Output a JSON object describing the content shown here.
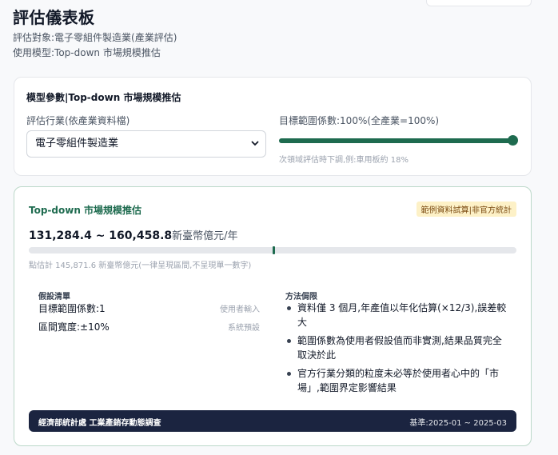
{
  "header": {
    "title": "評估儀表板",
    "target_line": "評估對象:電子零組件製造業(產業評估)",
    "model_line": "使用模型:Top-down 市場規模推估"
  },
  "params_card": {
    "title": "模型參數|Top-down 市場規模推估",
    "industry_label": "評估行業(依產業資料檔)",
    "industry_value": "電子零組件製造業",
    "range_label": "目標範圍係數:100%(全產業=100%)",
    "range_value_percent": 100,
    "range_hint": "次領域評估時下調,例:車用板約 18%"
  },
  "result_card": {
    "title": "Top-down 市場規模推估",
    "badge": "範例資料試算|非官方統計",
    "range_numbers": "131,284.4 ~ 160,458.8",
    "range_unit": "新臺幣億元/年",
    "point_fraction": 0.5,
    "point_note": "點估計 145,871.6 新臺幣億元(一律呈現區間,不呈現單一數字)",
    "assumptions_title": "假設清單",
    "assumptions": [
      {
        "label": "目標範圍係數:1",
        "source": "使用者輸入"
      },
      {
        "label": "區間寬度:±10%",
        "source": "系統預設"
      }
    ],
    "limits_title": "方法侷限",
    "limits": [
      "資料僅 3 個月,年產值以年化估算(×12/3),誤差較大",
      "範圍係數為使用者假設值而非實測,結果品質完全取決於此",
      "官方行業分類的粒度未必等於使用者心中的「市場」,範圍界定影響結果"
    ],
    "footer_source": "經濟部統計處 工業產銷存動態調查",
    "footer_basis": "基準:2025-01 ~ 2025-03"
  },
  "colors": {
    "accent_green": "#1e6b4f",
    "badge_bg": "#fdf1c7",
    "footer_bg": "#1b2440"
  }
}
